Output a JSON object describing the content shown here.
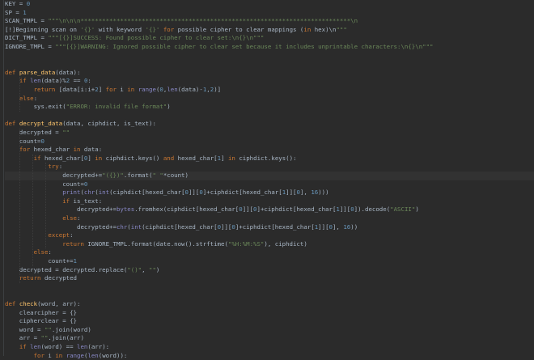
{
  "colors": {
    "background": "#2b2b2b",
    "text": "#a9b7c6",
    "keyword": "#cc7832",
    "string": "#6a8759",
    "number": "#6897bb",
    "function_name": "#ffc66d",
    "builtin": "#8888c6",
    "current_line": "#323232"
  },
  "code": {
    "lines": [
      "KEY = 0",
      "SP = 1",
      "SCAN_TMPL = \"\"\"\\n\\n\\n***************************************************************************\\n",
      "[!]Beginning scan on '{}' with keyword '{}' for possible cipher to clear mappings (in hex)\\n\"\"\"",
      "DICT_TMPL = \"\"\"[{}]SUCCESS: Found possible cipher to clear set:\\n{}\\n\"\"\"",
      "IGNORE_TMPL = \"\"\"[{}]WARNING: Ignored possible cipher to clear set because it includes unprintable characters:\\n{}\\n\"\"\"",
      "",
      "",
      "def parse_data(data):",
      "    if len(data)%2 == 0:",
      "        return [data[i:i+2] for i in range(0,len(data)-1,2)]",
      "    else:",
      "        sys.exit(\"ERROR: invalid file format\")",
      "",
      "def decrypt_data(data, ciphdict, is_text):",
      "    decrypted = \"\"",
      "    count=0",
      "    for hexed_char in data:",
      "        if hexed_char[0] in ciphdict.keys() and hexed_char[1] in ciphdict.keys():",
      "            try:",
      "                decrypted+=\"({})\".format(\" \"*count)",
      "                count=0",
      "                print(chr(int(ciphdict[hexed_char[0]][0]+ciphdict[hexed_char[1]][0], 16)))",
      "                if is_text:",
      "                    decrypted+=bytes.fromhex(ciphdict[hexed_char[0]][0]+ciphdict[hexed_char[1]][0]).decode(\"ASCII\")",
      "                else:",
      "                    decrypted+=chr(int(ciphdict[hexed_char[0]][0]+ciphdict[hexed_char[1]][0], 16))",
      "            except:",
      "                return IGNORE_TMPL.format(date.now().strftime(\"%H:%M:%S\"), ciphdict)",
      "        else:",
      "            count+=1",
      "    decrypted = decrypted.replace(\"()\", \"\")",
      "    return decrypted",
      "",
      "",
      "def check(word, arr):",
      "    clearcipher = {}",
      "    cipherclear = {}",
      "    word = \"\".join(word)",
      "    arr = \"\".join(arr)",
      "    if len(word) == len(arr):",
      "        for i in range(len(word)):"
    ]
  }
}
